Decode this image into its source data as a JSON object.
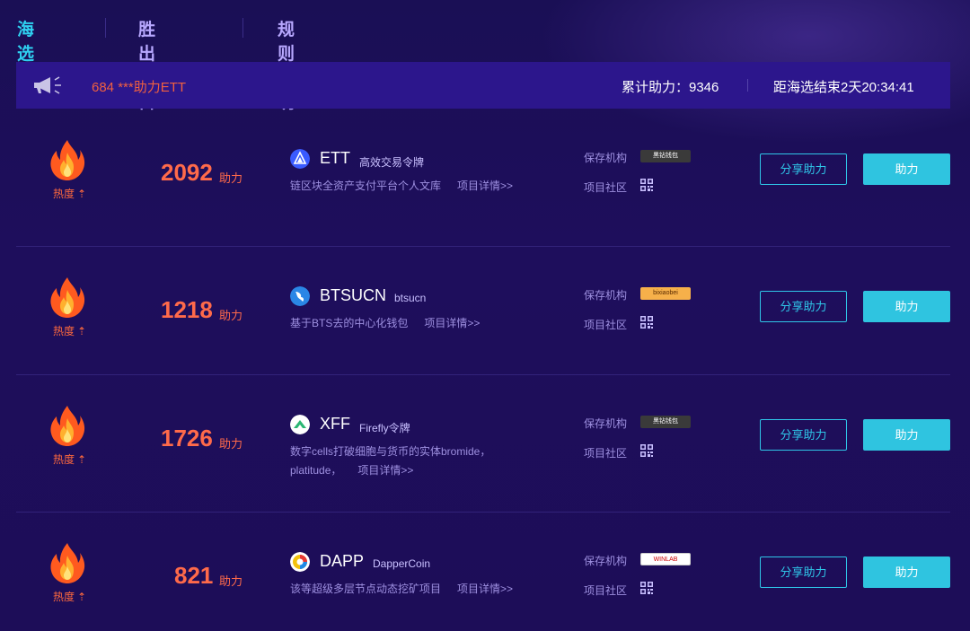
{
  "tabs": [
    {
      "label": "海选墙"
    },
    {
      "label": "胜出项目"
    },
    {
      "label": "规则说明"
    }
  ],
  "notice": {
    "message": "684 ***助力ETT",
    "total_label": "累计助力：9346",
    "countdown": "距海选结束2天20:34:41"
  },
  "projects": [
    {
      "heat_label": "热度",
      "support_count": "2092",
      "support_unit": "助力",
      "name": "ETT",
      "subtitle": "高效交易令牌",
      "description": "链区块全资产支付平台个人文库",
      "detail_link": "项目详情>>",
      "custody_label": "保存机构",
      "community_label": "项目社区",
      "badge": "黑钻钱包",
      "share_label": "分享助力",
      "help_label": "助力"
    },
    {
      "heat_label": "热度",
      "support_count": "1218",
      "support_unit": "助力",
      "name": "BTSUCN",
      "subtitle": "btsucn",
      "description": "基于BTS去的中心化钱包",
      "detail_link": "项目详情>>",
      "custody_label": "保存机构",
      "community_label": "项目社区",
      "badge": "bixiaobei",
      "share_label": "分享助力",
      "help_label": "助力"
    },
    {
      "heat_label": "热度",
      "support_count": "1726",
      "support_unit": "助力",
      "name": "XFF",
      "subtitle": "Firefly令牌",
      "description": "数字cells打破细胞与货币的实体bromide，platitude，",
      "detail_link": "项目详情>>",
      "custody_label": "保存机构",
      "community_label": "项目社区",
      "badge": "黑钻钱包",
      "share_label": "分享助力",
      "help_label": "助力"
    },
    {
      "heat_label": "热度",
      "support_count": "821",
      "support_unit": "助力",
      "name": "DAPP",
      "subtitle": "DapperCoin",
      "description": "该等超级多层节点动态挖矿项目",
      "detail_link": "项目详情>>",
      "custody_label": "保存机构",
      "community_label": "项目社区",
      "badge": "WINLAB",
      "share_label": "分享助力",
      "help_label": "助力"
    }
  ],
  "colors": {
    "accent": "#2fc4e0",
    "active_tab": "#2fd0f0",
    "heat": "#ff6a4a",
    "background": "#1d0d58",
    "notice_bar": "#2c168c"
  },
  "icons": {
    "notice": "megaphone-icon",
    "heat": "flame-icon",
    "community": "qr-code-icon"
  }
}
